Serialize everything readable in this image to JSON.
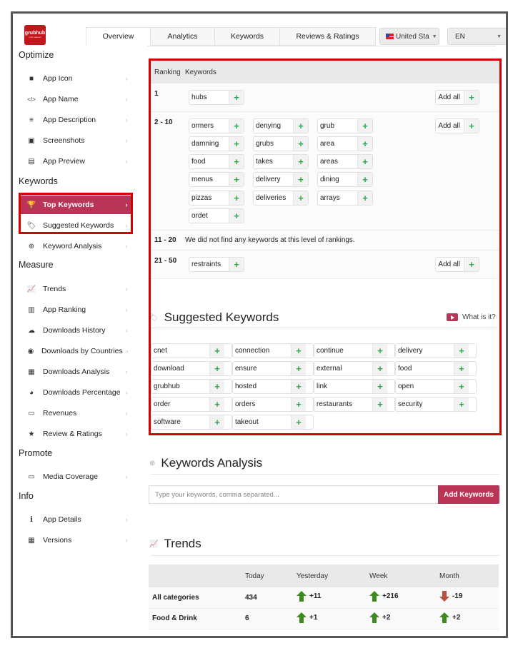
{
  "app": {
    "logo_text": "grubhub",
    "logo_sub": "order takeout"
  },
  "tabs": [
    {
      "label": "Overview",
      "active": true
    },
    {
      "label": "Analytics"
    },
    {
      "label": "Keywords"
    },
    {
      "label": "Reviews & Ratings"
    }
  ],
  "country_select": {
    "value": "United Sta",
    "flag": "us-flag-icon"
  },
  "language_select": {
    "value": "EN"
  },
  "sidebar": {
    "sections": [
      {
        "title": "Optimize",
        "items": [
          {
            "label": "App Icon",
            "icon": "square-icon"
          },
          {
            "label": "App Name",
            "icon": "code-icon"
          },
          {
            "label": "App Description",
            "icon": "align-left-icon"
          },
          {
            "label": "Screenshots",
            "icon": "image-icon"
          },
          {
            "label": "App Preview",
            "icon": "film-icon"
          }
        ]
      },
      {
        "title": "Keywords",
        "items": [
          {
            "label": "Top Keywords",
            "icon": "trophy-icon",
            "active": true
          },
          {
            "label": "Suggested Keywords",
            "icon": "tags-icon"
          },
          {
            "label": "Keyword Analysis",
            "icon": "search-plus-icon"
          }
        ]
      },
      {
        "title": "Measure",
        "items": [
          {
            "label": "Trends",
            "icon": "line-chart-icon"
          },
          {
            "label": "App Ranking",
            "icon": "bar-chart-icon"
          },
          {
            "label": "Downloads History",
            "icon": "cloud-download-icon"
          },
          {
            "label": "Downloads by Countries",
            "icon": "globe-icon"
          },
          {
            "label": "Downloads Analysis",
            "icon": "table-icon"
          },
          {
            "label": "Downloads Percentage",
            "icon": "pie-chart-icon"
          },
          {
            "label": "Revenues",
            "icon": "money-icon"
          },
          {
            "label": "Review & Ratings",
            "icon": "star-icon"
          }
        ]
      },
      {
        "title": "Promote",
        "items": [
          {
            "label": "Media Coverage",
            "icon": "desktop-icon"
          }
        ]
      },
      {
        "title": "Info",
        "items": [
          {
            "label": "App Details",
            "icon": "info-icon"
          },
          {
            "label": "Versions",
            "icon": "calendar-icon"
          }
        ]
      }
    ]
  },
  "top_keywords": {
    "headers": {
      "ranking": "Ranking",
      "keywords": "Keywords"
    },
    "add_all_label": "Add all",
    "rows": [
      {
        "rank": "1",
        "keywords": [
          "hubs"
        ],
        "add_all": true
      },
      {
        "rank": "2 - 10",
        "keywords": [
          "ormers",
          "denying",
          "grub",
          "damning",
          "grubs",
          "area",
          "food",
          "takes",
          "areas",
          "menus",
          "delivery",
          "dining",
          "pizzas",
          "deliveries",
          "arrays",
          "ordet"
        ],
        "add_all": true
      },
      {
        "rank": "11 - 20",
        "message": "We did not find any keywords at this level of rankings."
      },
      {
        "rank": "21 - 50",
        "keywords": [
          "restraints"
        ],
        "add_all": true
      }
    ]
  },
  "suggested_keywords": {
    "title": "Suggested Keywords",
    "what_is_it": "What is it?",
    "keywords": [
      "cnet",
      "connection",
      "continue",
      "delivery",
      "download",
      "ensure",
      "external",
      "food",
      "grubhub",
      "hosted",
      "link",
      "open",
      "order",
      "orders",
      "restaurants",
      "security",
      "software",
      "takeout"
    ]
  },
  "keywords_analysis": {
    "title": "Keywords Analysis",
    "input_value": "",
    "input_placeholder": "Type your keywords, comma separated...",
    "button_label": "Add Keywords"
  },
  "trends": {
    "title": "Trends",
    "headers": [
      "",
      "Today",
      "Yesterday",
      "Week",
      "Month"
    ],
    "rows": [
      {
        "category": "All categories",
        "today": "434",
        "yesterday": {
          "value": "+11",
          "dir": "up"
        },
        "week": {
          "value": "+216",
          "dir": "up"
        },
        "month": {
          "value": "-19",
          "dir": "down"
        }
      },
      {
        "category": "Food & Drink",
        "today": "6",
        "yesterday": {
          "value": "+1",
          "dir": "up"
        },
        "week": {
          "value": "+2",
          "dir": "up"
        },
        "month": {
          "value": "+2",
          "dir": "up"
        }
      }
    ]
  },
  "colors": {
    "accent": "#b83558",
    "highlight_border": "#d40000",
    "plus_green": "#2ea84a",
    "trend_up": "#3d8a1e",
    "trend_down": "#b5523b",
    "logo_red": "#c0161c"
  }
}
